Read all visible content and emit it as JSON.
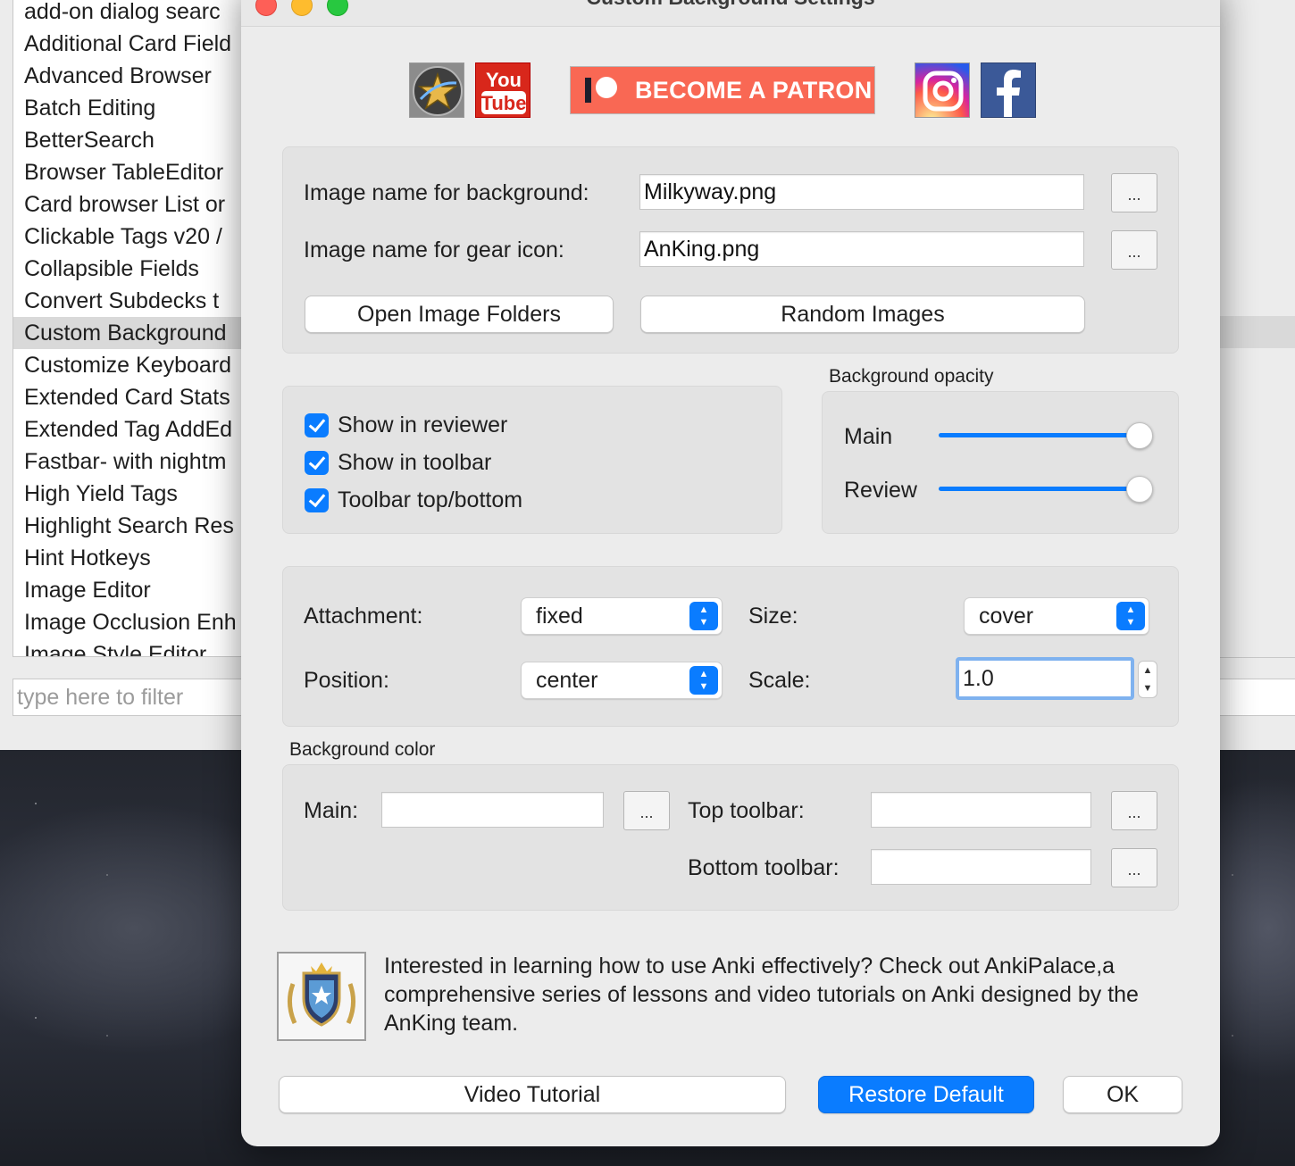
{
  "addon_list": {
    "items": [
      "add-on dialog searc",
      "Additional Card Field",
      "Advanced Browser",
      "Batch Editing",
      "BetterSearch",
      "Browser TableEditor",
      "Card browser List or",
      "Clickable Tags v20 /",
      "Collapsible Fields",
      "Convert Subdecks t",
      "Custom Background",
      "Customize Keyboard",
      "Extended Card Stats",
      "Extended Tag AddEd",
      "Fastbar- with nightm",
      "High Yield Tags",
      "Highlight Search Res",
      "Hint Hotkeys",
      "Image Editor",
      "Image Occlusion Enh",
      "Image Style Editor"
    ],
    "selected_index": 10,
    "filter_placeholder": "type here to filter"
  },
  "dialog": {
    "title": "Custom Background Settings",
    "social": {
      "youtube_top": "You",
      "youtube_bottom": "Tube",
      "patron_label": "BECOME A PATRON"
    },
    "images": {
      "background_label": "Image name for background:",
      "background_value": "Milkyway.png",
      "gear_label": "Image name for gear icon:",
      "gear_value": "AnKing.png",
      "browse_label": "...",
      "open_folders_label": "Open Image Folders",
      "random_label": "Random Images"
    },
    "options": {
      "show_in_reviewer": "Show in reviewer",
      "show_in_toolbar": "Show in toolbar",
      "toolbar_top_bottom": "Toolbar top/bottom",
      "checked": [
        true,
        true,
        true
      ]
    },
    "opacity": {
      "title": "Background opacity",
      "main_label": "Main",
      "review_label": "Review",
      "main_value": 1.0,
      "review_value": 1.0
    },
    "layout": {
      "attachment_label": "Attachment:",
      "attachment_value": "fixed",
      "size_label": "Size:",
      "size_value": "cover",
      "position_label": "Position:",
      "position_value": "center",
      "scale_label": "Scale:",
      "scale_value": "1.0"
    },
    "color": {
      "title": "Background color",
      "main_label": "Main:",
      "top_toolbar_label": "Top toolbar:",
      "bottom_toolbar_label": "Bottom toolbar:",
      "browse_label": "..."
    },
    "promo": {
      "text": "Interested in learning how to use Anki effectively? Check out AnkiPalace,a comprehensive series of lessons and video tutorials on Anki designed by the AnKing team."
    },
    "buttons": {
      "video_tutorial": "Video Tutorial",
      "restore_default": "Restore Default",
      "ok": "OK"
    }
  },
  "colors": {
    "accent": "#0a7cff",
    "patron": "#f96854",
    "facebook": "#3b5998"
  }
}
